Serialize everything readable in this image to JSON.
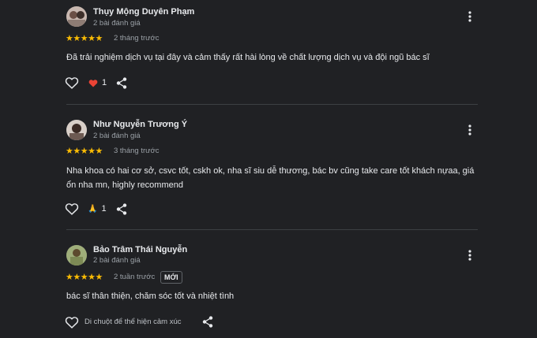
{
  "reviews": [
    {
      "author": "Thụy Mộng Duyên Phạm",
      "review_count": "2 bài đánh giá",
      "stars": "★★★★★",
      "rating": 5,
      "time": "2 tháng trước",
      "text": "Đã trải nghiệm dịch vụ tại đây và cảm thấy rất hài lòng về chất lượng dịch vụ và đội ngũ bác sĩ",
      "reaction_icon": "red-heart-icon",
      "reaction_count": "1"
    },
    {
      "author": "Như Nguyễn Trương Ý",
      "review_count": "2 bài đánh giá",
      "stars": "★★★★★",
      "rating": 5,
      "time": "3 tháng trước",
      "text": "Nha khoa có hai cơ sở, csvc tốt, cskh ok, nha sĩ siu dễ thương, bác bv cũng take care tốt khách nựaa, giá ổn nha mn, highly recommend",
      "reaction_icon": "folded-hands-icon",
      "reaction_glyph": "🙏",
      "reaction_count": "1"
    },
    {
      "author": "Bảo Trâm Thái Nguyễn",
      "review_count": "2 bài đánh giá",
      "stars": "★★★★★",
      "rating": 5,
      "time": "2 tuần trước",
      "badge": "MỚI",
      "text": "bác sĩ thân thiện, chăm sóc tốt và nhiệt tình",
      "hover_hint": "Di chuột để thể hiện cảm xúc"
    }
  ],
  "colors": {
    "background": "#202124",
    "star": "#fbbc04",
    "heart": "#ea4335",
    "secondary_text": "#9aa0a6",
    "divider": "#3c4043"
  }
}
